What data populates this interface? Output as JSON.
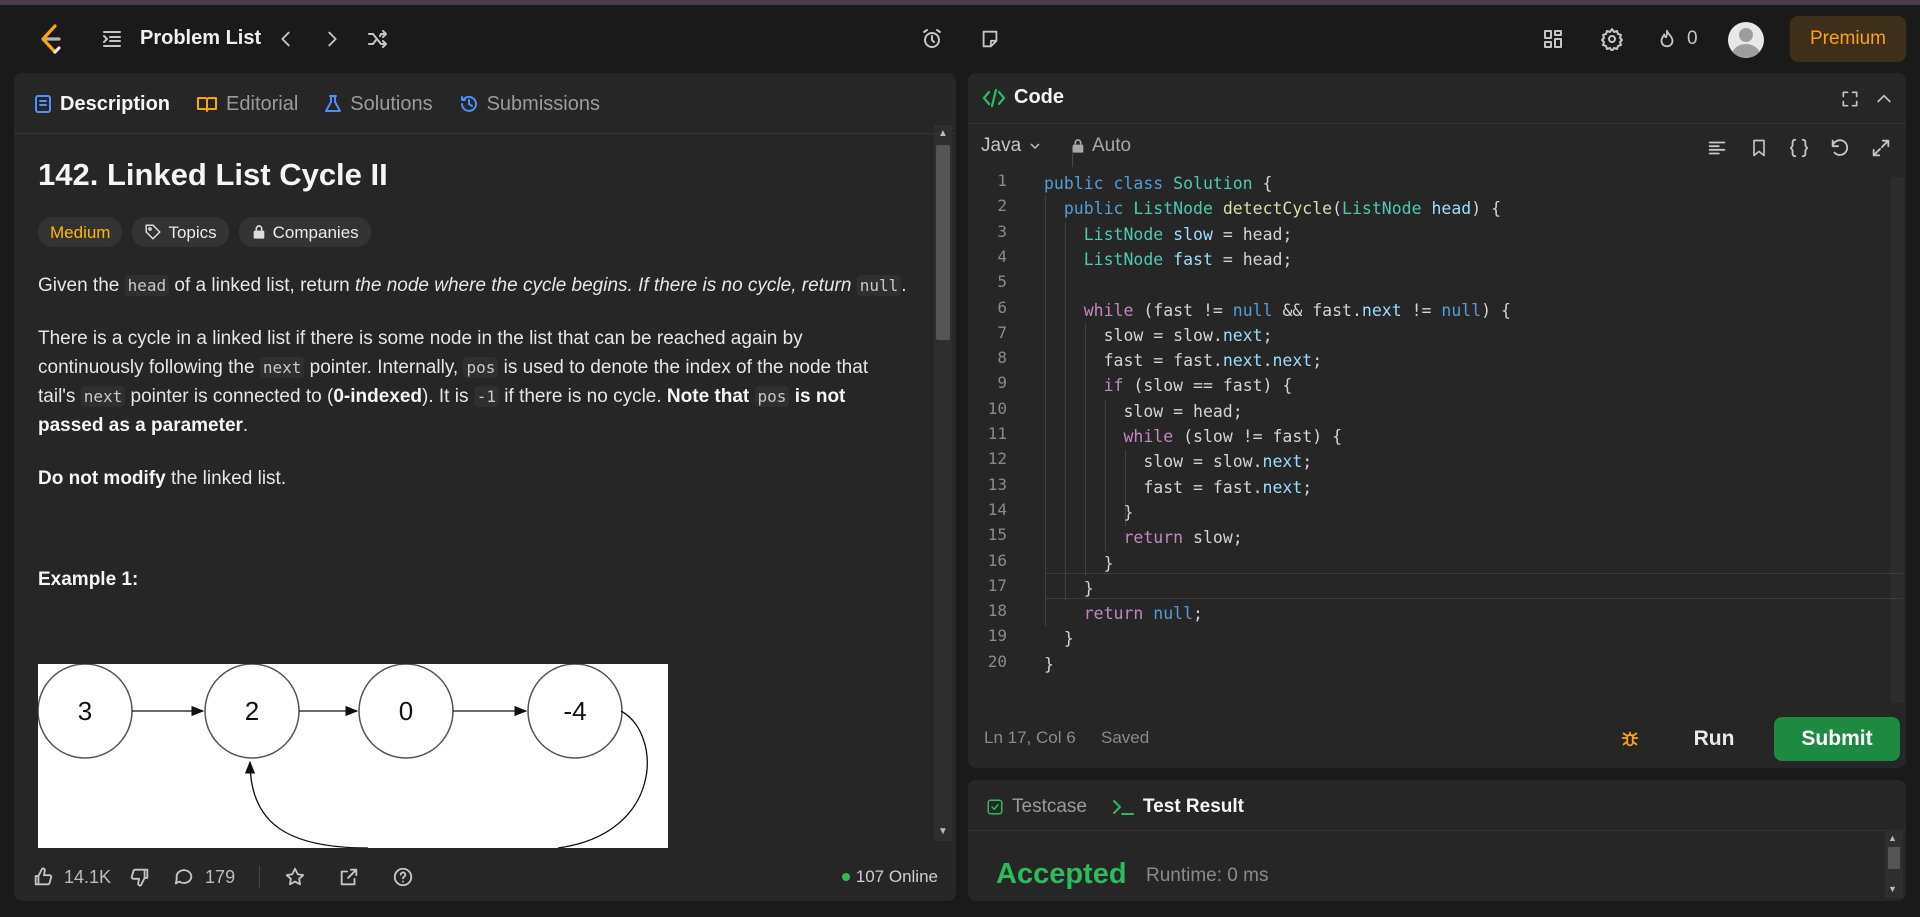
{
  "topbar": {
    "problem_list": "Problem List",
    "streak_count": "0",
    "premium": "Premium",
    "colors": {
      "premium_bg": "#3e2f1a",
      "premium_text": "#ffa116"
    }
  },
  "left_tabs": [
    {
      "label": "Description",
      "icon": "description-icon"
    },
    {
      "label": "Editorial",
      "icon": "book-icon"
    },
    {
      "label": "Solutions",
      "icon": "flask-icon"
    },
    {
      "label": "Submissions",
      "icon": "history-icon"
    }
  ],
  "problem": {
    "title": "142. Linked List Cycle II",
    "difficulty": "Medium",
    "topics": "Topics",
    "companies": "Companies",
    "p1": {
      "a": "Given the ",
      "code1": "head",
      "b": " of a linked list, return ",
      "em": "the node where the cycle begins. If there is no cycle, return ",
      "code2": "null",
      "c": "."
    },
    "p2": {
      "a": "There is a cycle in a linked list if there is some node in the list that can be reached again by continuously following the ",
      "code1": "next",
      "b": " pointer. Internally, ",
      "code2": "pos",
      "c": " is used to denote the index of the node that tail's ",
      "code3": "next",
      "d": " pointer is connected to (",
      "bold1": "0-indexed",
      "e": "). It is ",
      "code4": "-1",
      "f": " if there is no cycle. ",
      "bold2a": "Note that ",
      "code5": "pos",
      "bold2b": " is not passed as a parameter",
      "g": "."
    },
    "p3": {
      "bold": "Do not modify",
      "rest": " the linked list."
    },
    "example_title": "Example 1:",
    "diagram_nodes": [
      "3",
      "2",
      "0",
      "-4"
    ]
  },
  "left_footer": {
    "likes": "14.1K",
    "comments": "179",
    "online": "107 Online"
  },
  "code_panel": {
    "title": "Code",
    "language": "Java",
    "mode": "Auto",
    "line_numbers": [
      "1",
      "2",
      "3",
      "4",
      "5",
      "6",
      "7",
      "8",
      "9",
      "10",
      "11",
      "12",
      "13",
      "14",
      "15",
      "16",
      "17",
      "18",
      "19",
      "20"
    ],
    "status_position": "Ln 17, Col 6",
    "status_saved": "Saved",
    "run": "Run",
    "submit": "Submit"
  },
  "bottom_panel": {
    "tab_testcase": "Testcase",
    "tab_result": "Test Result",
    "result": "Accepted",
    "runtime": "Runtime: 0 ms"
  }
}
